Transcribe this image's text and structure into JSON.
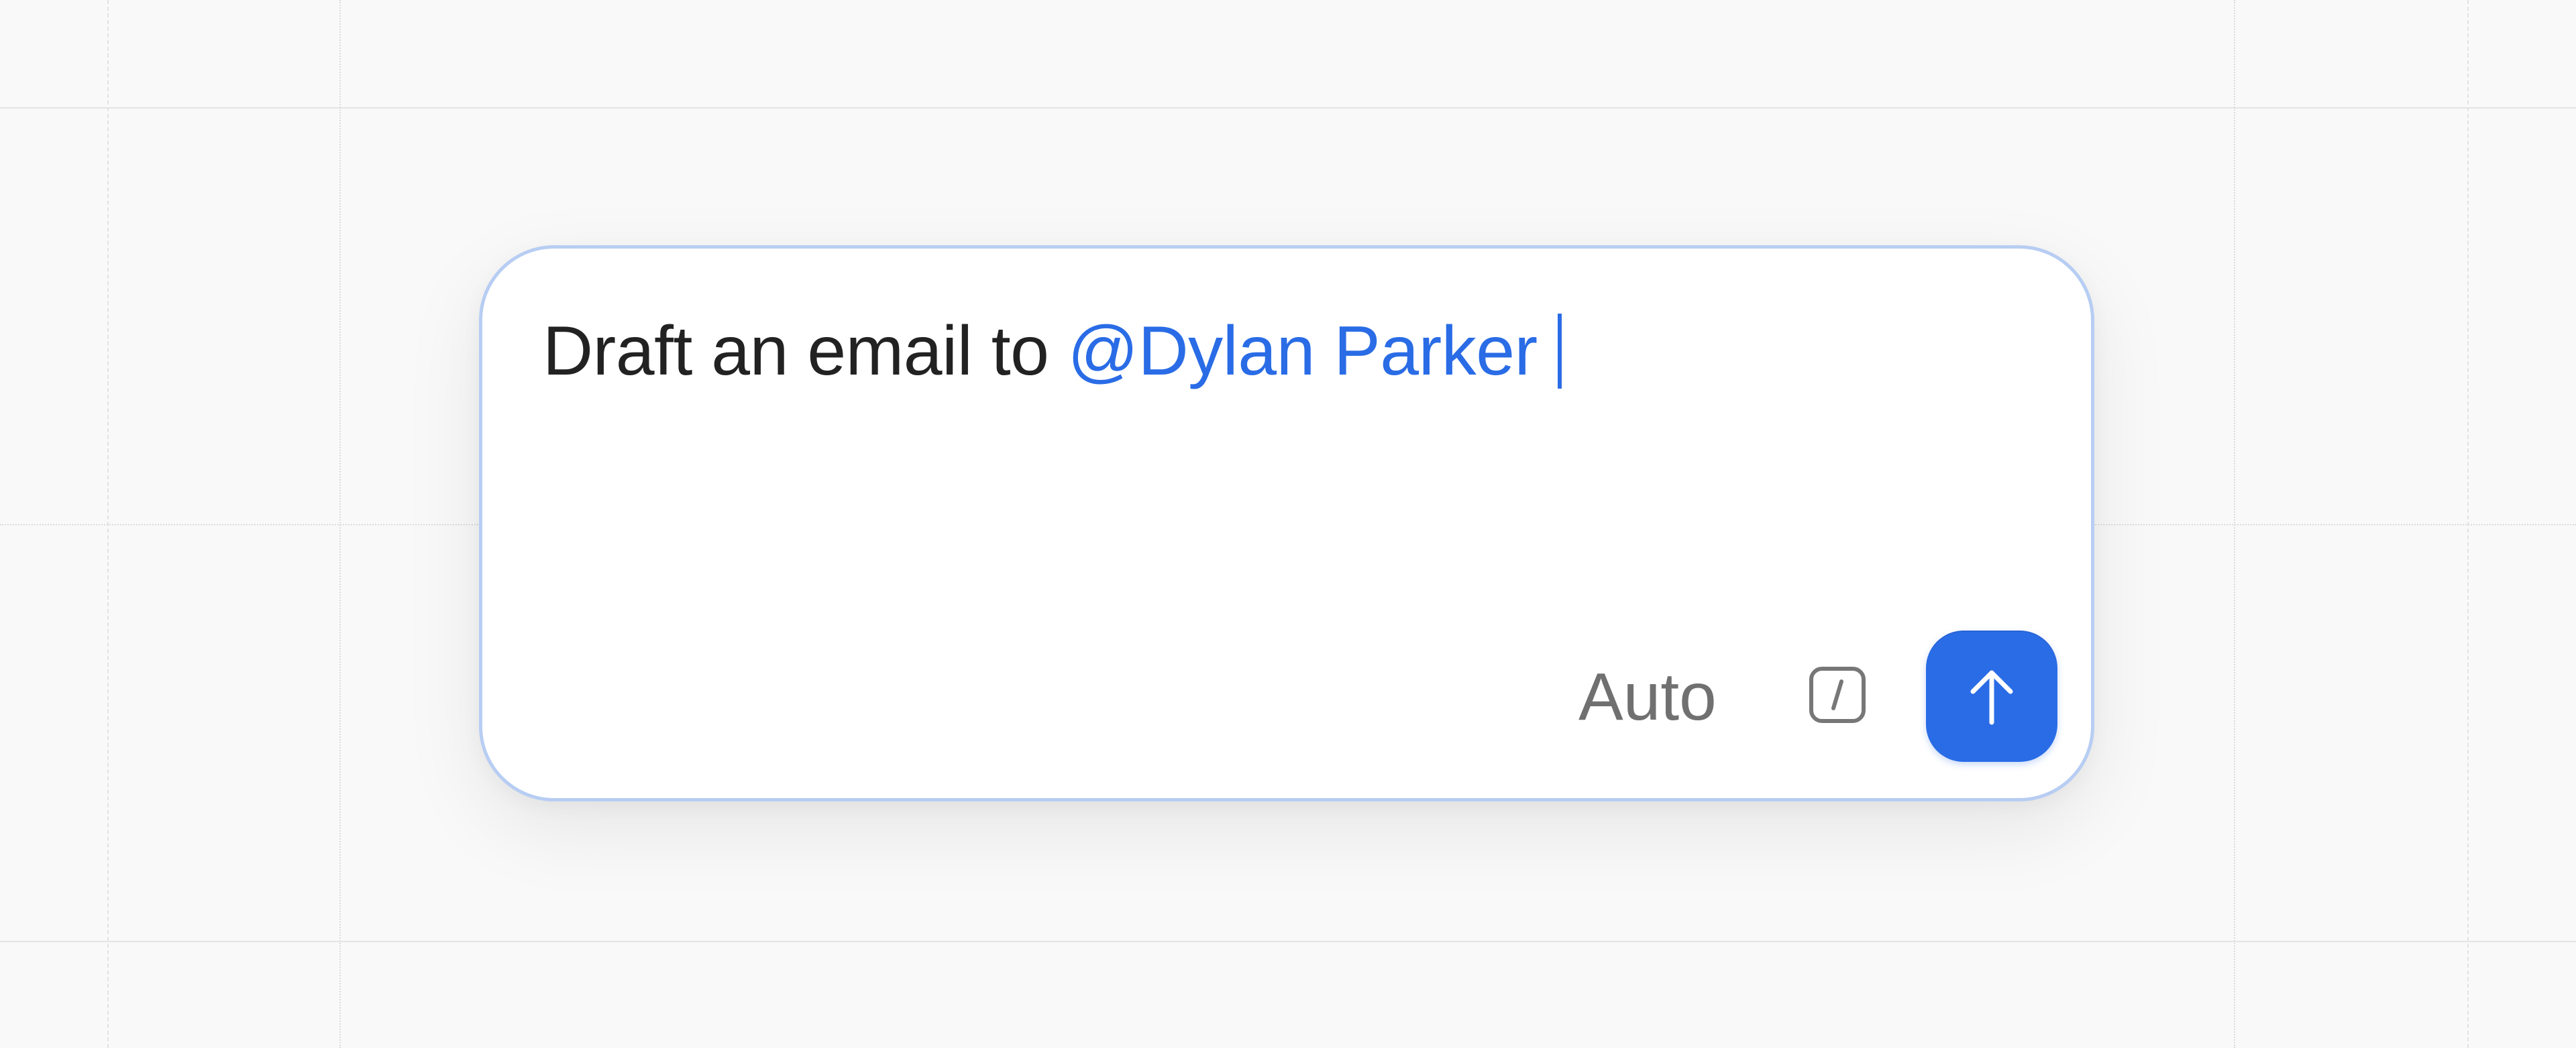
{
  "composer": {
    "prompt_text": "Draft an email to",
    "mention": "@Dylan Parker",
    "mode_label": "Auto",
    "shortcut_key": "/",
    "send_icon": "arrow-up-icon",
    "shortcut_icon": "slash-command-icon"
  },
  "colors": {
    "accent": "#2a6ce6",
    "border": "#b7cdf3",
    "background": "#f9f9f9",
    "text": "#222222",
    "muted": "#707070"
  }
}
